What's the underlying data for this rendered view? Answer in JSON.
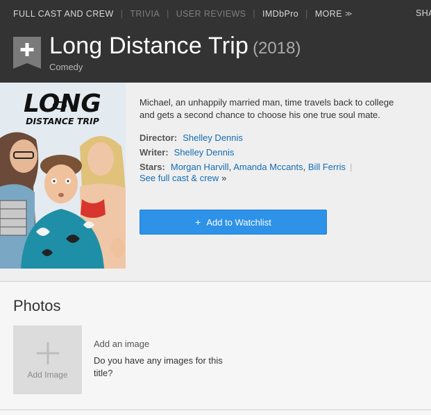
{
  "nav": {
    "full_cast": "FULL CAST AND CREW",
    "trivia": "TRIVIA",
    "user_reviews": "USER REVIEWS",
    "imdbpro": "IMDbPro",
    "more": "MORE",
    "sep": "|",
    "share": "SHA"
  },
  "title": {
    "name": "Long Distance Trip",
    "year": "(2018)",
    "genre": "Comedy"
  },
  "poster": {
    "line1": "LONG",
    "line2": "DISTANCE TRIP"
  },
  "overview": {
    "plot_line1": "Michael, an unhappily married man, time travels back to college",
    "plot_line2": "and gets a second chance to choose his one true soul mate.",
    "director_label": "Director:",
    "director": "Shelley Dennis",
    "writer_label": "Writer:",
    "writer": "Shelley Dennis",
    "stars_label": "Stars:",
    "stars": [
      "Morgan Harvill",
      "Amanda Mccants",
      "Bill Ferris"
    ],
    "comma": ",",
    "pipe": "|",
    "see_full": "See full cast & crew",
    "raquo": "»",
    "watchlist_plus": "+",
    "watchlist": "Add to Watchlist"
  },
  "photos": {
    "heading": "Photos",
    "tile_label": "Add Image",
    "add_heading": "Add an image",
    "add_question": "Do you have any images for this title?"
  },
  "colors": {
    "header_bg": "#333333",
    "link": "#136cb2",
    "button": "#2d92e8"
  }
}
